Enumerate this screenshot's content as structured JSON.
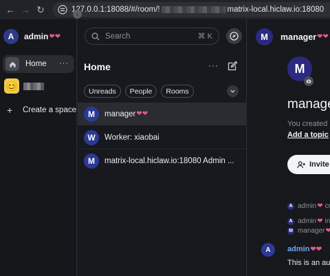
{
  "browser": {
    "url_prefix": "127.0.0.1:18088/#/room/!",
    "url_suffix": "matrix-local.hiclaw.io:18080"
  },
  "spaces": {
    "user_avatar": "A",
    "user_name": "admin",
    "items": [
      {
        "label": "Home",
        "icon": "home-icon"
      },
      {
        "label": "Create a space",
        "icon": "plus-icon"
      }
    ],
    "more_label": "···"
  },
  "roomlist": {
    "search_placeholder": "Search",
    "search_shortcut": "⌘ K",
    "title": "Home",
    "more_label": "···",
    "filters": [
      "Unreads",
      "People",
      "Rooms"
    ],
    "rooms": [
      {
        "avatar": "M",
        "name": "manager"
      },
      {
        "avatar": "W",
        "name": "Worker: xiaobai"
      },
      {
        "avatar": "M",
        "name": "matrix-local.hiclaw.io:18080 Admin ..."
      }
    ]
  },
  "main": {
    "header_avatar": "M",
    "header_name": "manager",
    "big_avatar": "M",
    "title": "manage",
    "created_text": "You created",
    "add_topic": "Add a topic",
    "invite_label": "Invite t",
    "events": [
      {
        "avatar": "A",
        "who": "admin",
        "text": "cr"
      },
      {
        "avatar": "A",
        "who": "admin",
        "text": "in"
      },
      {
        "avatar": "M",
        "who": "manager",
        "text": ""
      }
    ],
    "message": {
      "avatar": "A",
      "sender": "admin",
      "body": "This is an aut"
    }
  },
  "colors": {
    "accent": "#2b3a94",
    "link": "#6ea8f5",
    "hearts": "#e05a8a"
  }
}
